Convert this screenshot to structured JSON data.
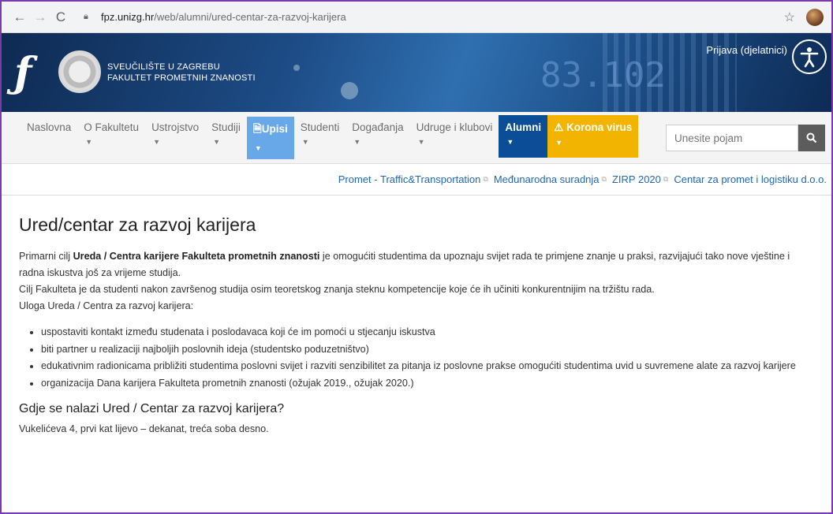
{
  "browser": {
    "url_host": "fpz.unizg.hr",
    "url_path": "/web/alumni/ured-centar-za-razvoj-karijera"
  },
  "header": {
    "university_line1": "SVEUČILIŠTE U ZAGREBU",
    "university_line2": "FAKULTET PROMETNIH ZNANOSTI",
    "login_label": "Prijava (djelatnici)",
    "banner_text": "83.102"
  },
  "nav": {
    "items": [
      {
        "label": "Naslovna"
      },
      {
        "label": "O Fakultetu"
      },
      {
        "label": "Ustrojstvo"
      },
      {
        "label": "Studiji"
      },
      {
        "label": "Upisi"
      },
      {
        "label": "Studenti"
      },
      {
        "label": "Događanja"
      },
      {
        "label": "Udruge i klubovi"
      },
      {
        "label": "Alumni"
      },
      {
        "label": "Korona virus"
      }
    ],
    "search_placeholder": "Unesite pojam",
    "colors": {
      "upisi": "#68a7e8",
      "alumni": "#0b4e97",
      "korona": "#f3b400"
    }
  },
  "subnav": {
    "links": [
      "Promet - Traffic&Transportation",
      "Međunarodna suradnja",
      "ZIRP 2020",
      "Centar za promet i logistiku d.o.o."
    ]
  },
  "content": {
    "title": "Ured/centar za razvoj karijera",
    "intro_prefix": "Primarni cilj ",
    "intro_bold": "Ureda / Centra karijere Fakulteta prometnih znanosti",
    "intro_suffix": " je omogućiti studentima da upoznaju svijet rada te primjene znanje u praksi, razvijajući tako nove vještine i radna iskustva još za vrijeme studija.",
    "goal": "Cilj Fakulteta je da studenti nakon završenog studija osim teoretskog znanja steknu kompetencije koje će ih učiniti konkurentnijim na tržištu rada.",
    "roles_heading": "Uloga Ureda / Centra za razvoj karijera:",
    "roles": [
      "uspostaviti kontakt između studenata i poslodavaca koji će im pomoći u stjecanju iskustva",
      "biti partner u realizaciji najboljih poslovnih ideja (studentsko poduzetništvo)",
      "edukativnim radionicama približiti studentima poslovni svijet i razviti senzibilitet za pitanja iz poslovne prakse omogućiti studentima uvid u suvremene alate za razvoj karijere",
      "organizacija Dana karijera Fakulteta prometnih znanosti (ožujak 2019., ožujak 2020.)"
    ],
    "location_heading": "Gdje se nalazi Ured / Centar za razvoj karijera?",
    "location_text": "Vukelićeva 4, prvi kat lijevo – dekanat, treća soba desno."
  }
}
